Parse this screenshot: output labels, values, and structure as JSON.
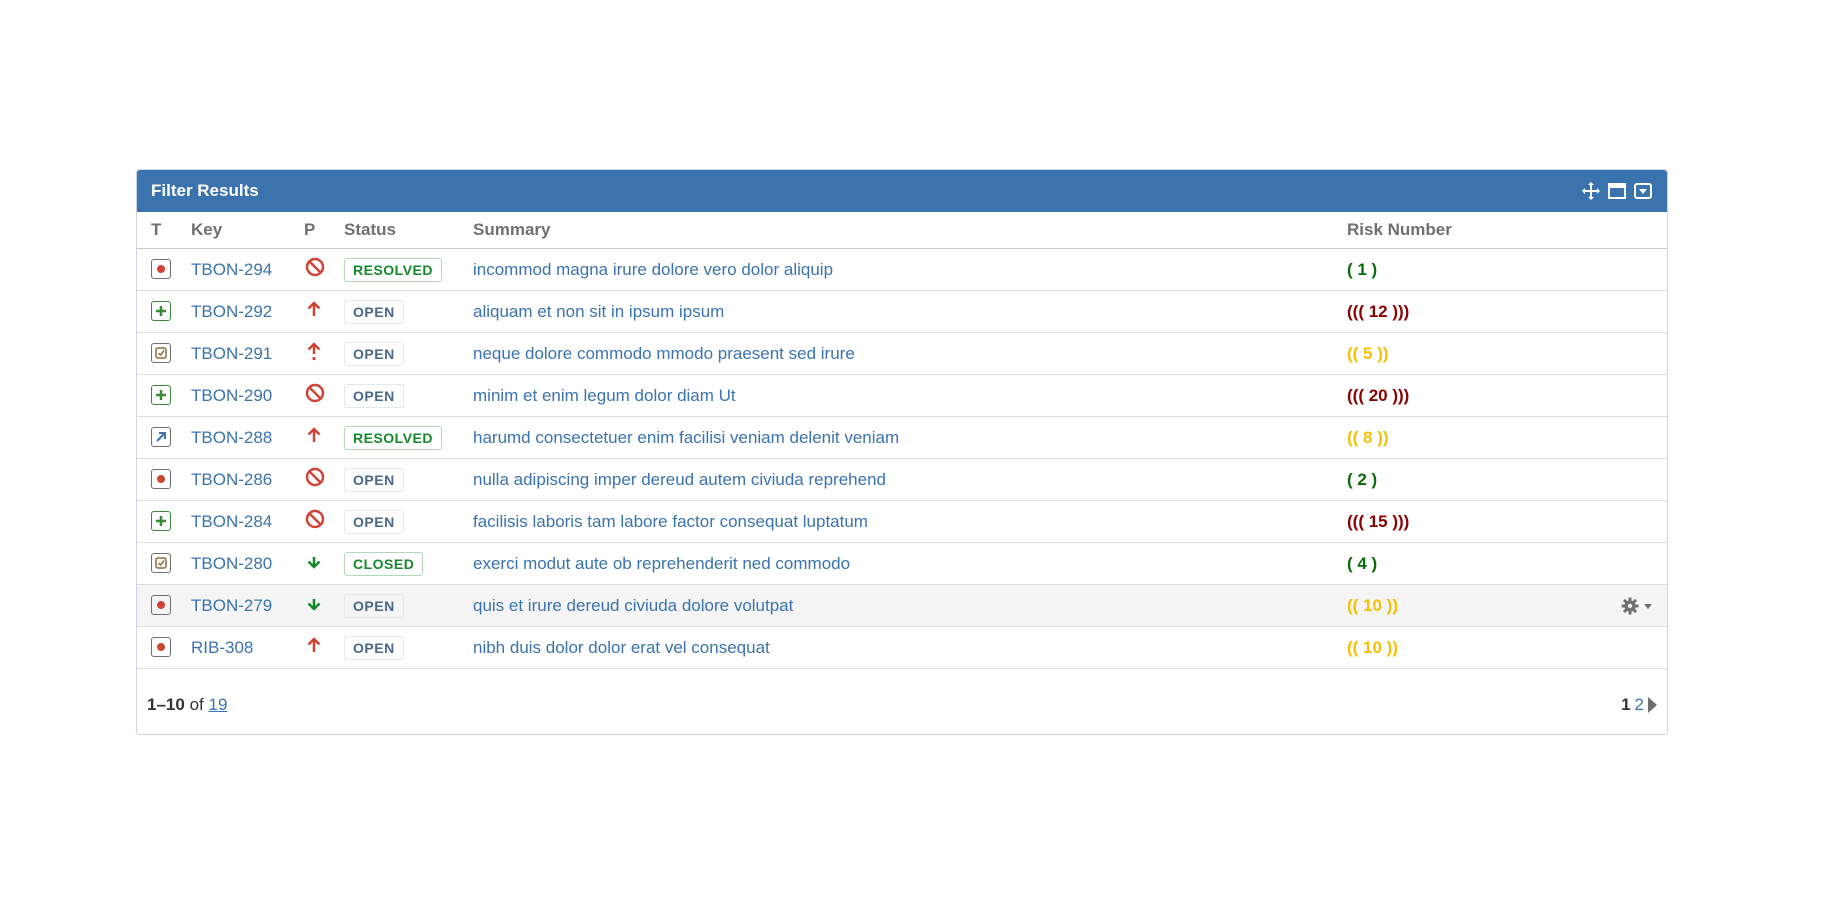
{
  "gadget": {
    "title": "Filter Results",
    "header_icons": [
      "move-icon",
      "maximize-icon",
      "collapse-dropdown-icon"
    ]
  },
  "columns": {
    "t": "T",
    "key": "Key",
    "p": "P",
    "status": "Status",
    "summary": "Summary",
    "risk": "Risk Number"
  },
  "rows": [
    {
      "type": "bug",
      "key": "TBON-294",
      "priority": "blocker",
      "status": "RESOLVED",
      "summary": "incommod magna irure dolore vero dolor aliquip",
      "risk": "( 1 )",
      "risk_level": "low"
    },
    {
      "type": "new-feature",
      "key": "TBON-292",
      "priority": "major",
      "status": "OPEN",
      "summary": "aliquam et non sit in ipsum ipsum",
      "risk": "((( 12 )))",
      "risk_level": "high"
    },
    {
      "type": "task",
      "key": "TBON-291",
      "priority": "critical",
      "status": "OPEN",
      "summary": "neque dolore commodo mmodo praesent sed irure",
      "risk": "(( 5 ))",
      "risk_level": "med"
    },
    {
      "type": "new-feature",
      "key": "TBON-290",
      "priority": "blocker",
      "status": "OPEN",
      "summary": "minim et enim legum dolor diam Ut",
      "risk": "((( 20 )))",
      "risk_level": "high"
    },
    {
      "type": "improvement",
      "key": "TBON-288",
      "priority": "major",
      "status": "RESOLVED",
      "summary": "harumd consectetuer enim facilisi veniam delenit veniam",
      "risk": "(( 8 ))",
      "risk_level": "med"
    },
    {
      "type": "bug",
      "key": "TBON-286",
      "priority": "blocker",
      "status": "OPEN",
      "summary": "nulla adipiscing imper dereud autem civiuda reprehend",
      "risk": "( 2 )",
      "risk_level": "low"
    },
    {
      "type": "new-feature",
      "key": "TBON-284",
      "priority": "blocker",
      "status": "OPEN",
      "summary": "facilisis laboris tam labore factor consequat luptatum",
      "risk": "((( 15 )))",
      "risk_level": "high"
    },
    {
      "type": "task",
      "key": "TBON-280",
      "priority": "minor",
      "status": "CLOSED",
      "summary": "exerci modut aute ob reprehenderit ned commodo",
      "risk": "( 4 )",
      "risk_level": "low"
    },
    {
      "type": "bug",
      "key": "TBON-279",
      "priority": "minor",
      "status": "OPEN",
      "summary": "quis et irure dereud civiuda dolore volutpat",
      "risk": "(( 10 ))",
      "risk_level": "med",
      "hovered": true
    },
    {
      "type": "bug",
      "key": "RIB-308",
      "priority": "major",
      "status": "OPEN",
      "summary": "nibh duis dolor dolor erat vel consequat",
      "risk": "(( 10 ))",
      "risk_level": "med"
    }
  ],
  "footer": {
    "range": "1–10",
    "of": "of",
    "total": "19",
    "current_page": "1",
    "next_page": "2"
  },
  "colors": {
    "header_bg": "#3b73af",
    "link": "#3b73af",
    "risk_low": "#0a6b0a",
    "risk_med": "#f5c000",
    "risk_high": "#8b0000",
    "priority_red": "#d04437",
    "priority_green": "#14892c"
  }
}
